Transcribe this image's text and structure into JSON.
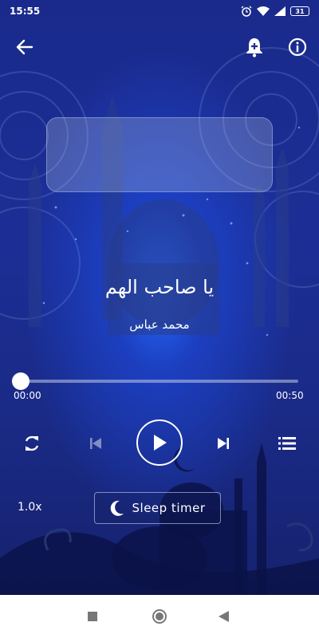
{
  "status_bar": {
    "time": "15:55",
    "battery": "31",
    "icons": [
      "alarm-clock-icon",
      "wifi-icon",
      "signal-icon",
      "battery-icon"
    ]
  },
  "header": {
    "icons": [
      "back-arrow-icon",
      "bell-add-icon",
      "info-icon"
    ]
  },
  "track": {
    "title": "يا صاحب الهم",
    "artist": "محمد عباس"
  },
  "progress": {
    "elapsed": "00:00",
    "total": "00:50",
    "fraction": 0.0
  },
  "controls": {
    "icons": [
      "repeat-icon",
      "skip-previous-icon",
      "play-icon",
      "skip-next-icon",
      "playlist-icon"
    ],
    "speed": "1.0x",
    "sleep_timer": "Sleep timer"
  },
  "colors": {
    "background": "#1c2e96",
    "glow": "#2a6bff",
    "foreground": "#ffffff"
  }
}
